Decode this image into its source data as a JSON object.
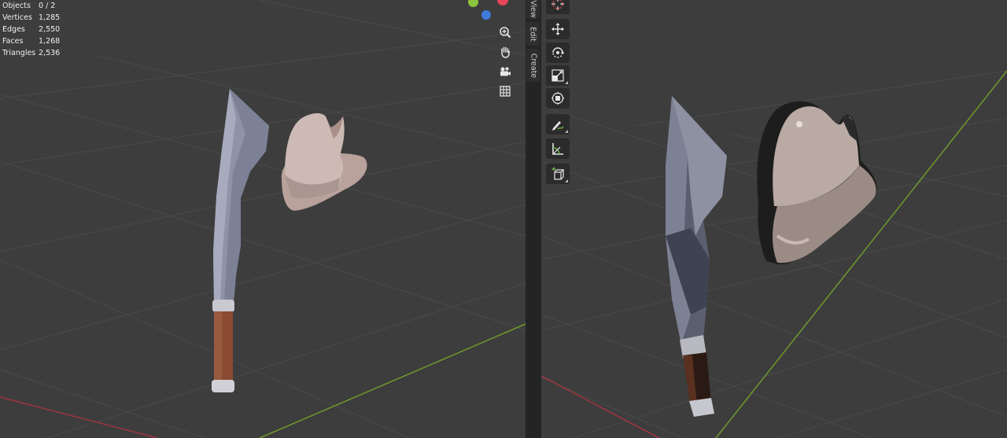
{
  "stats": [
    {
      "label": "Objects",
      "value": "0 / 2"
    },
    {
      "label": "Vertices",
      "value": "1,285"
    },
    {
      "label": "Edges",
      "value": "2,550"
    },
    {
      "label": "Faces",
      "value": "1,268"
    },
    {
      "label": "Triangles",
      "value": "2,536"
    }
  ],
  "side_tabs": [
    "View",
    "Edit",
    "Create"
  ],
  "nav_controls": [
    "zoom-icon",
    "hand-pan-icon",
    "camera-icon",
    "grid-icon"
  ],
  "tools": [
    "cursor-icon",
    "move-icon",
    "rotate-icon",
    "scale-icon",
    "transform-icon",
    "annotate-icon",
    "measure-icon",
    "add-cube-icon"
  ],
  "colors": {
    "viewport_bg": "#3d3d3d",
    "grid_line": "#4a4a4a",
    "x_axis": "#a0353f",
    "y_axis": "#6f9a2c",
    "blade": "#8a8fa5",
    "handle": "#8b4a32",
    "helmet": "#bfa8a2"
  }
}
